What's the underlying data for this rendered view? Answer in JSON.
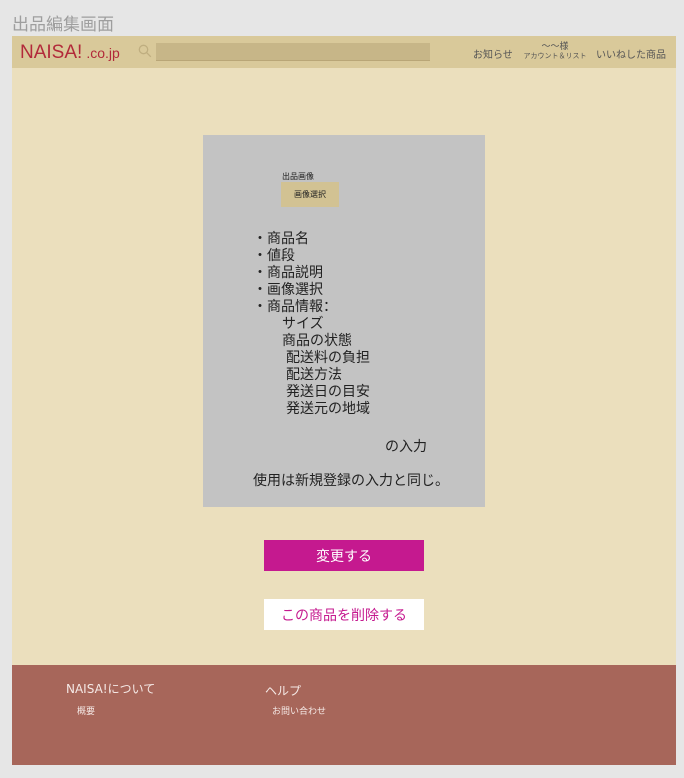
{
  "page": {
    "title": "出品編集画面"
  },
  "header": {
    "logo_main": "NAISA!",
    "logo_suffix": ".co.jp",
    "search_icon": "search-icon",
    "search_placeholder": "",
    "notifications": "お知らせ",
    "account_name": "〜〜様",
    "account_sub": "アカウント＆リスト",
    "liked_items": "いいねした商品"
  },
  "form": {
    "image_label": "出品画像",
    "image_select_button": "画像選択",
    "fields": [
      "・商品名",
      "・値段",
      "・商品説明",
      "・画像選択",
      "・商品情報："
    ],
    "product_info_items": [
      "サイズ",
      "商品の状態"
    ],
    "shipping_items": [
      "配送料の負担",
      "配送方法",
      "発送日の目安",
      "発送元の地域"
    ],
    "input_suffix": "の入力",
    "note": "使用は新規登録の入力と同じ。"
  },
  "actions": {
    "update": "変更する",
    "delete": "この商品を削除する"
  },
  "footer": {
    "about_heading": "NAISA!について",
    "about_link": "概要",
    "help_heading": "ヘルプ",
    "help_link": "お問い合わせ"
  },
  "colors": {
    "background": "#ebdfbd",
    "header": "#d9c99a",
    "panel": "#c3c3c3",
    "accent": "#c5198f",
    "logo": "#b22a3a",
    "footer": "#a7665a"
  }
}
